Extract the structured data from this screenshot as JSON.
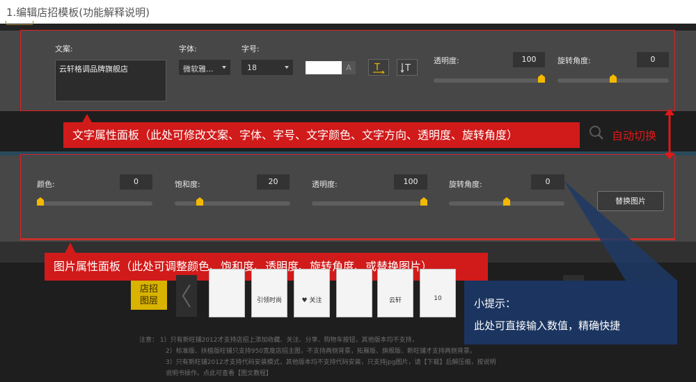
{
  "caption": "1.编辑店招模板(功能解释说明)",
  "text_panel": {
    "copy_label": "文案:",
    "copy_value": "云轩格调品牌旗舰店",
    "font_label": "字体:",
    "font_value": "微软雅...",
    "size_label": "字号:",
    "size_value": "18",
    "color_swatch_letter": "A",
    "opacity_label": "透明度:",
    "opacity_value": "100",
    "opacity_level": 1.0,
    "rotation_label": "旋转角度:",
    "rotation_value": "0",
    "rotation_level": 0.5
  },
  "image_panel": {
    "color_label": "颜色:",
    "color_value": "0",
    "color_level": 0.0,
    "saturation_label": "饱和度:",
    "saturation_value": "20",
    "saturation_level": 0.2,
    "opacity_label": "透明度:",
    "opacity_value": "100",
    "opacity_level": 1.0,
    "rotation_label": "旋转角度:",
    "rotation_value": "0",
    "rotation_level": 0.5,
    "replace_button": "替换图片"
  },
  "callouts": {
    "text_panel": "文字属性面板（此处可修改文案、字体、字号、文字颜色、文字方向、透明度、旋转角度）",
    "image_panel": "图片属性面板（此处可调整颜色、饱和度、透明度、旋转角度、或替换图片）",
    "auto_switch": "自动切换",
    "tip_title": "小提示：",
    "tip_body": "此处可直接输入数值，精确快捷"
  },
  "layer_strip": {
    "layer_label_1": "店招",
    "layer_label_2": "图层",
    "cards": [
      "",
      "引领时尚",
      "♥ 关注",
      "",
      "云轩",
      "10"
    ]
  },
  "notes": [
    "注意：  1）只有新旺铺2012才支持店招上添加收藏、关注、分享、购物车按钮，其他版本均不支持，",
    "2）标准版、扶植版旺铺只支持950宽度店招主图，不支持两侧背景，拓展版、旗舰版、新旺铺才支持两侧背景。",
    "3）只有新旺铺2012才支持代码安装模式，其他版本均不支持代码安装，只支持jpg图片，请【下载】后解压缩，按说明",
    "说明书操作。点此可查看【图文教程】"
  ],
  "colors": {
    "panel": "#474747",
    "callout_red": "#d11a1a",
    "outline_red": "#e02020",
    "slider_thumb": "#f5b800",
    "active_text_icon": "#f0b400"
  }
}
